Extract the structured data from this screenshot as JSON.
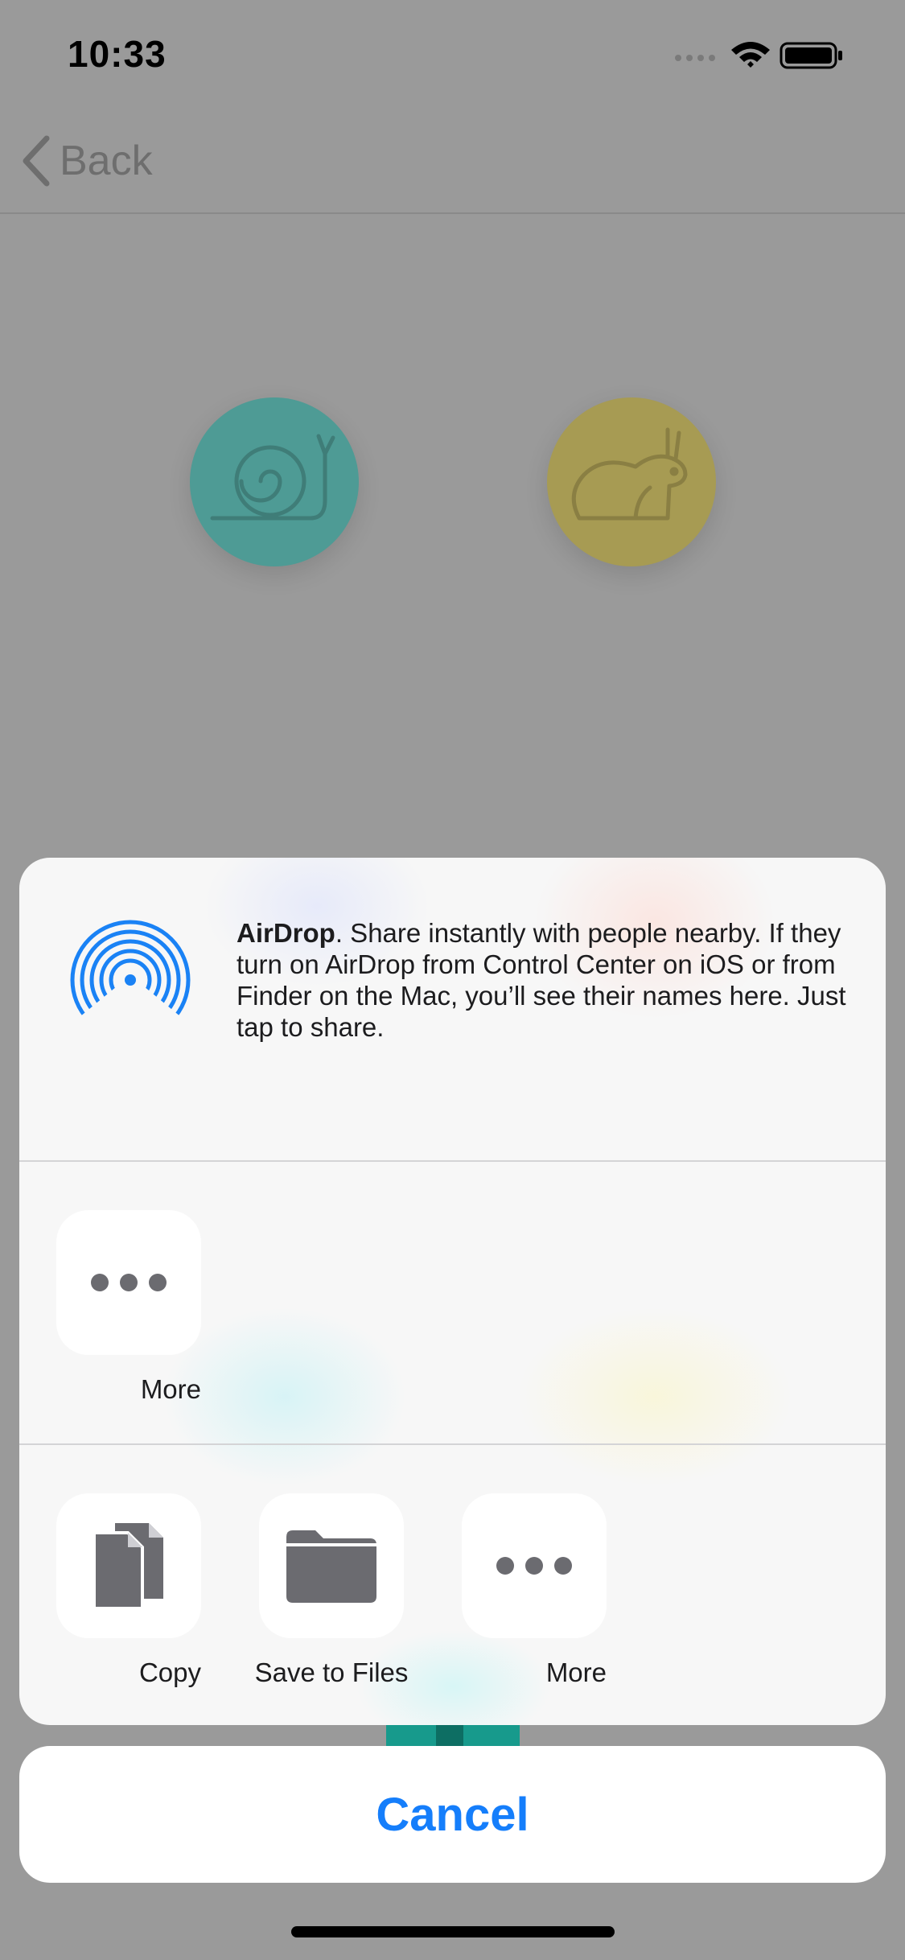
{
  "status_bar": {
    "time": "10:33",
    "icons": [
      "signal-icon",
      "wifi-icon",
      "battery-icon"
    ]
  },
  "nav": {
    "back_label": "Back"
  },
  "background_icons": [
    "snail-icon",
    "rabbit-icon"
  ],
  "share_sheet": {
    "airdrop": {
      "title": "AirDrop",
      "description": ". Share instantly with people nearby. If they turn on AirDrop from Control Center on iOS or from Finder on the Mac, you’ll see their names here. Just tap to share."
    },
    "apps_row": [
      {
        "label": "More",
        "icon": "more-icon"
      }
    ],
    "actions_row": [
      {
        "label": "Copy",
        "icon": "copy-icon"
      },
      {
        "label": "Save to Files",
        "icon": "folder-icon"
      },
      {
        "label": "More",
        "icon": "more-icon"
      }
    ]
  },
  "cancel_label": "Cancel",
  "colors": {
    "accent": "#157efb",
    "airdrop_blue": "#1a82f5",
    "snail_circle": "#4e9b95",
    "rabbit_circle": "#a79b53",
    "dim_background": "#9a9a9a"
  }
}
